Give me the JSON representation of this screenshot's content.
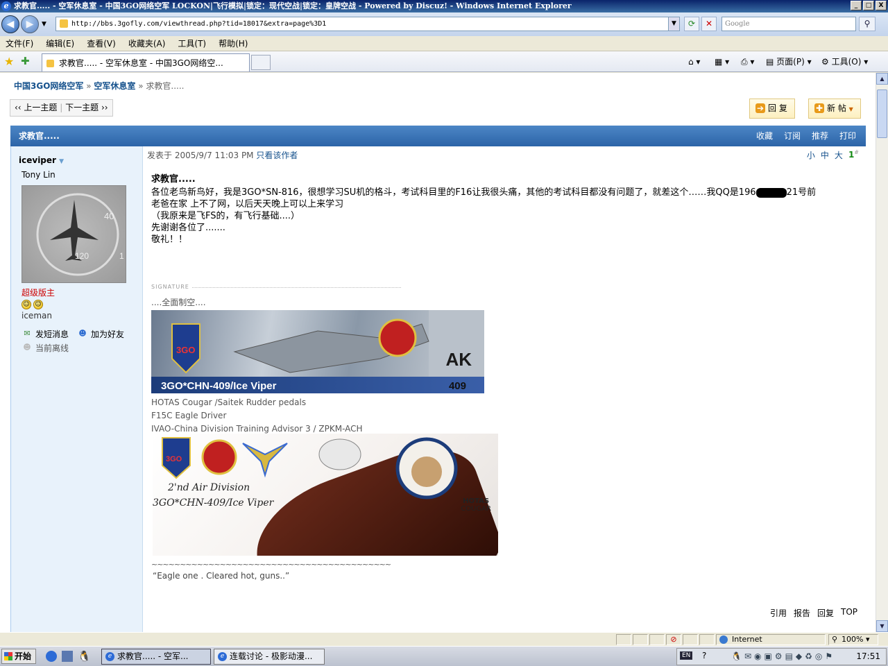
{
  "window": {
    "title": "求教官..... - 空军休息室 - 中国3GO网络空军 LOCKON|飞行模拟|锁定：现代空战|锁定：皇牌空战 - Powered by Discuz! - Windows Internet Explorer",
    "min": "_",
    "max": "□",
    "close": "X"
  },
  "browser": {
    "url": "http://bbs.3gofly.com/viewthread.php?tid=18017&extra=page%3D1",
    "search_placeholder": "Google",
    "menu": [
      "文件(F)",
      "编辑(E)",
      "查看(V)",
      "收藏夹(A)",
      "工具(T)",
      "帮助(H)"
    ],
    "tab_title": "求教官..... - 空军休息室 - 中国3GO网络空...",
    "page_menu": "页面(P)",
    "tools_menu": "工具(O)"
  },
  "breadcrumb": {
    "site": "中国3GO网络空军",
    "forum": "空军休息室",
    "thread": "求教官.....",
    "sep": "»"
  },
  "nav": {
    "prev": "上一主题",
    "next": "下一主题"
  },
  "actions": {
    "reply": "回 复",
    "newpost": "新 帖"
  },
  "thread": {
    "title": "求教官.....",
    "header_links": [
      "收藏",
      "订阅",
      "推荐",
      "打印"
    ]
  },
  "author": {
    "username": "iceviper",
    "real_name": "Tony Lin",
    "rank": "超级版主",
    "group": "iceman",
    "send_msg": "发短消息",
    "add_friend": "加为好友",
    "status": "当前离线"
  },
  "post": {
    "posted_label": "发表于",
    "time": "2005/9/7 11:03 PM",
    "only_author": "只看该作者",
    "font_small": "小",
    "font_mid": "中",
    "font_large": "大",
    "floor": "1",
    "floor_suffix": "#",
    "title": "求教官.....",
    "body_line1_a": "各位老鸟新鸟好，我是3GO*SN-816，很想学习SU机的格斗，考试科目里的F16让我很头痛，其他的考试科目都没有问题了，就差这个……我QQ是196",
    "body_line1_b": "21号前",
    "body_line2": "老爸在家 上不了网，以后天天晚上可以上来学习",
    "body_line3": "（我原来是飞FS的，有飞行基础....）",
    "body_line4": "先谢谢各位了.......",
    "body_line5": "敬礼！！"
  },
  "signature": {
    "label": "SIGNATURE",
    "line0": "....全面制空....",
    "banner1_text": "3GO*CHN-409/Ice Viper",
    "banner1_ak": "AK",
    "banner1_num": "409",
    "line1": "HOTAS Cougar /Saitek Rudder pedals",
    "line2": "F15C Eagle  Driver",
    "line3": "IVAO-China Division Training Advisor 3 / ZPKM-ACH",
    "banner2_l1": "2'nd Air Division",
    "banner2_l2": "3GO*CHN-409/Ice Viper",
    "banner2_hc": "HOTAS",
    "banner2_hc2": "COUGAR",
    "tilde": "~~~~~~~~~~~~~~~~~~~~~~~~~~~~~~~~~~~~~~~~~~",
    "quote": "“Eagle one . Cleared hot, guns..”"
  },
  "post_actions": [
    "引用",
    "报告",
    "回复",
    "TOP"
  ],
  "statusbar": {
    "zone": "Internet",
    "zoom": "100%"
  },
  "taskbar": {
    "start": "开始",
    "task1": "求教官..... - 空军...",
    "task2": "连载讨论 - 极影动漫...",
    "time": "17:51",
    "lang": "EN"
  }
}
